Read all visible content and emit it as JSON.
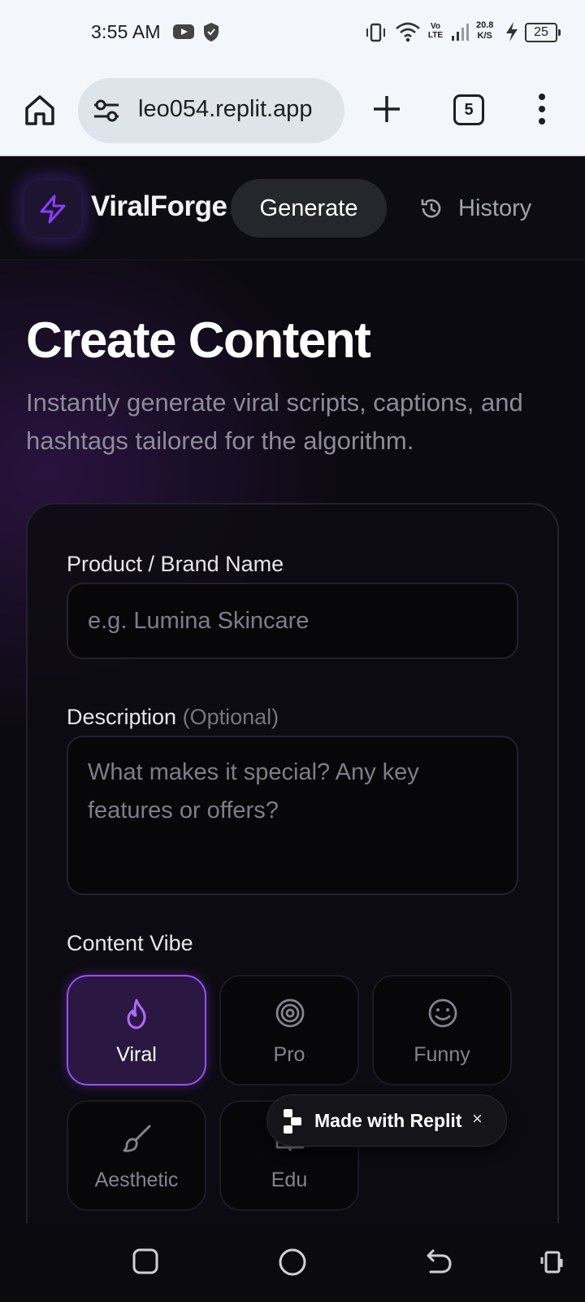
{
  "status_bar": {
    "time": "3:55 AM",
    "network_label": "Vo LTE",
    "speed_value": "20.8",
    "speed_unit": "K/S",
    "battery": "25"
  },
  "browser": {
    "url": "leo054.replit.app",
    "tab_count": "5"
  },
  "app_nav": {
    "brand": "ViralForge",
    "generate_label": "Generate",
    "history_label": "History"
  },
  "page": {
    "title": "Create Content",
    "subtitle": "Instantly generate viral scripts, captions, and hashtags tailored for the algorithm."
  },
  "form": {
    "product_label": "Product / Brand Name",
    "product_placeholder": "e.g. Lumina Skincare",
    "description_label": "Description",
    "description_optional": "(Optional)",
    "description_placeholder": "What makes it special? Any key features or offers?",
    "vibe_label": "Content Vibe",
    "vibes": [
      {
        "label": "Viral",
        "icon": "flame-icon",
        "selected": true
      },
      {
        "label": "Pro",
        "icon": "target-icon",
        "selected": false
      },
      {
        "label": "Funny",
        "icon": "smile-icon",
        "selected": false
      },
      {
        "label": "Aesthetic",
        "icon": "brush-icon",
        "selected": false
      },
      {
        "label": "Edu",
        "icon": "book-icon",
        "selected": false
      }
    ]
  },
  "badge": {
    "text": "Made with Replit",
    "close": "×"
  },
  "colors": {
    "accent": "#9b4cff",
    "background": "#0b0a10"
  }
}
